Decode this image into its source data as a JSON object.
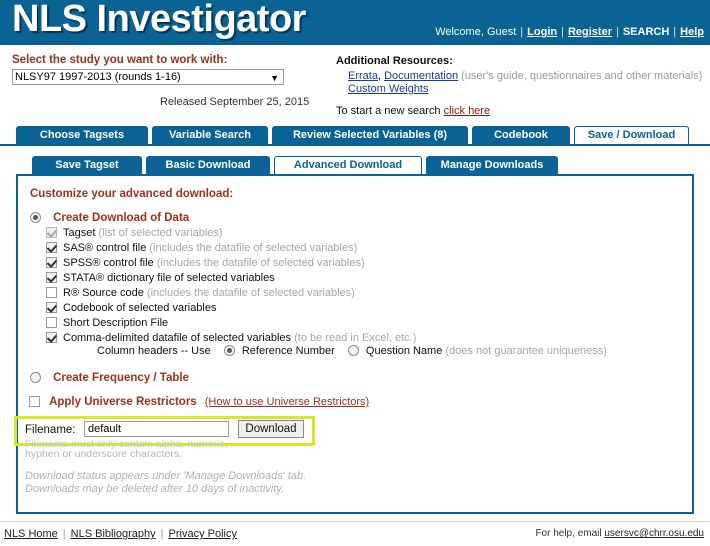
{
  "header": {
    "brand": "NLS Investigator",
    "welcome": "Welcome, Guest",
    "login": "Login",
    "register": "Register",
    "search": "SEARCH",
    "help": "Help",
    "bg_color": "#0a6394"
  },
  "study": {
    "label": "Select the study you want to work with:",
    "selected": "NLSY97 1997-2013 (rounds 1-16)",
    "released": "Released September 25, 2015"
  },
  "resources": {
    "title": "Additional Resources:",
    "errata": "Errata",
    "documentation": "Documentation",
    "doc_note": "(user's guide, questionnaires and other materials)",
    "custom_weights": "Custom Weights",
    "new_search_text": "To start a new search",
    "new_search_link": "click here"
  },
  "tabs": [
    {
      "label": "Choose Tagsets",
      "active": false
    },
    {
      "label": "Variable Search",
      "active": false
    },
    {
      "label": "Review Selected Variables (8)",
      "active": false
    },
    {
      "label": "Codebook",
      "active": false
    },
    {
      "label": "Save / Download",
      "active": true
    }
  ],
  "subtabs": [
    {
      "label": "Save Tagset",
      "active": false
    },
    {
      "label": "Basic Download",
      "active": false
    },
    {
      "label": "Advanced Download",
      "active": true
    },
    {
      "label": "Manage Downloads",
      "active": false
    }
  ],
  "panel": {
    "title": "Customize your advanced download:",
    "create_download": {
      "label": "Create Download of Data",
      "selected": true
    },
    "create_frequency": {
      "label": "Create Frequency / Table",
      "selected": false
    },
    "universe": {
      "label": "Apply Universe Restrictors",
      "link": "(How to use Universe Restrictors)",
      "checked": false
    },
    "checkboxes": [
      {
        "label": "Tagset",
        "note": " (list of selected variables)",
        "checked": true,
        "disabled": true
      },
      {
        "label": "SAS® control file",
        "note": " (includes the datafile of selected variables)",
        "checked": true,
        "disabled": false
      },
      {
        "label": "SPSS® control file",
        "note": " (includes the datafile of selected variables)",
        "checked": true,
        "disabled": false
      },
      {
        "label": "STATA® dictionary file of selected variables",
        "note": "",
        "checked": true,
        "disabled": false
      },
      {
        "label": "R® Source code",
        "note": " (includes the datafile of selected variables)",
        "checked": false,
        "disabled": false
      },
      {
        "label": "Codebook of selected variables",
        "note": "",
        "checked": true,
        "disabled": false
      },
      {
        "label": "Short Description File",
        "note": "",
        "checked": false,
        "disabled": false
      },
      {
        "label": "Comma-delimited datafile of selected variables",
        "note": " (to be read in Excel, etc.)",
        "checked": true,
        "disabled": false
      }
    ],
    "column_headers": {
      "prefix": "Column headers -- Use",
      "option1": "Reference Number",
      "option2": "Question Name",
      "option2_note": "(does not guarantee uniqueness)",
      "selected": "Reference Number"
    },
    "filename": {
      "label": "Filename:",
      "value": "default",
      "placeholder": "",
      "button": "Download",
      "hint_line1": "Filename must only contain alpha, numeric,",
      "hint_line2": "hyphen or underscore characters.",
      "highlight_color": "#d6e928"
    },
    "status_note_1": "Download status appears under 'Manage Downloads' tab.",
    "status_note_2": "Downloads may be deleted after 10 days of inactivity."
  },
  "footer": {
    "home": "NLS Home",
    "bibliography": "NLS Bibliography",
    "privacy": "Privacy Policy",
    "help_text": "For help, email",
    "help_email": "usersvc@chrr.osu.edu"
  }
}
